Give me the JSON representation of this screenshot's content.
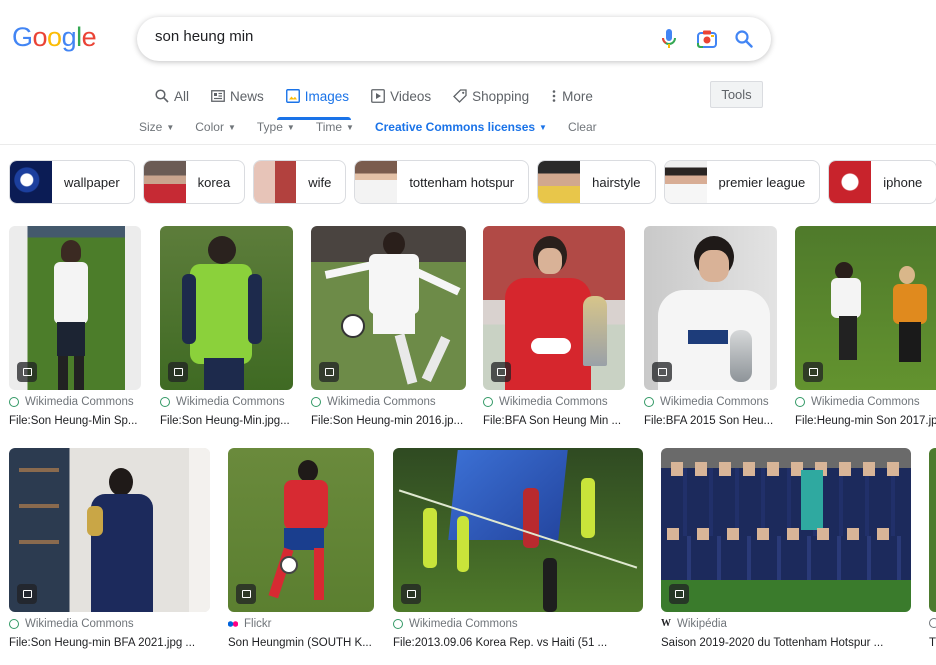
{
  "logo": {
    "letters": [
      "G",
      "o",
      "o",
      "g",
      "l",
      "e"
    ],
    "colors": [
      "#4285f4",
      "#ea4335",
      "#fbbc05",
      "#4285f4",
      "#34a853",
      "#ea4335"
    ]
  },
  "search": {
    "query": "son heung min"
  },
  "tabs": [
    {
      "label": "All",
      "icon": "search-icon"
    },
    {
      "label": "News",
      "icon": "news-icon"
    },
    {
      "label": "Images",
      "icon": "images-icon",
      "active": true
    },
    {
      "label": "Videos",
      "icon": "video-icon"
    },
    {
      "label": "Shopping",
      "icon": "tag-icon"
    },
    {
      "label": "More",
      "icon": "more-icon"
    }
  ],
  "tools_label": "Tools",
  "filters": {
    "size": "Size",
    "color": "Color",
    "type": "Type",
    "time": "Time",
    "license": "Creative Commons licenses",
    "clear": "Clear"
  },
  "chips": [
    {
      "label": "wallpaper"
    },
    {
      "label": "korea"
    },
    {
      "label": "wife"
    },
    {
      "label": "tottenham hotspur"
    },
    {
      "label": "hairstyle"
    },
    {
      "label": "premier league"
    },
    {
      "label": "iphone"
    }
  ],
  "results": [
    {
      "source": "Wikimedia Commons",
      "title": "File:Son Heung-Min Sp...",
      "src_icon": "wikimedia-icon"
    },
    {
      "source": "Wikimedia Commons",
      "title": "File:Son Heung-Min.jpg...",
      "src_icon": "wikimedia-icon"
    },
    {
      "source": "Wikimedia Commons",
      "title": "File:Son Heung-min 2016.jp...",
      "src_icon": "wikimedia-icon"
    },
    {
      "source": "Wikimedia Commons",
      "title": "File:BFA Son Heung Min ...",
      "src_icon": "wikimedia-icon"
    },
    {
      "source": "Wikimedia Commons",
      "title": "File:BFA 2015 Son Heu...",
      "src_icon": "wikimedia-icon"
    },
    {
      "source": "Wikimedia Commons",
      "title": "File:Heung-min Son 2017.jp...",
      "src_icon": "wikimedia-icon"
    },
    {
      "source": "Wikimedia Commons",
      "title": "File:Son Heung-min BFA 2021.jpg ...",
      "src_icon": "wikimedia-icon"
    },
    {
      "source": "Flickr",
      "title": "Son Heungmin (SOUTH K...",
      "src_icon": "flickr-icon"
    },
    {
      "source": "Wikimedia Commons",
      "title": "File:2013.09.06 Korea Rep. vs Haiti (51 ...",
      "src_icon": "wikimedia-icon"
    },
    {
      "source": "Wikipédia",
      "title": "Saison 2019-2020 du Tottenham Hotspur ...",
      "src_icon": "wikipedia-icon"
    },
    {
      "source": "",
      "title": "T",
      "src_icon": "globe-icon"
    }
  ],
  "colors": {
    "accent": "#1a73e8",
    "muted": "#70757a"
  }
}
